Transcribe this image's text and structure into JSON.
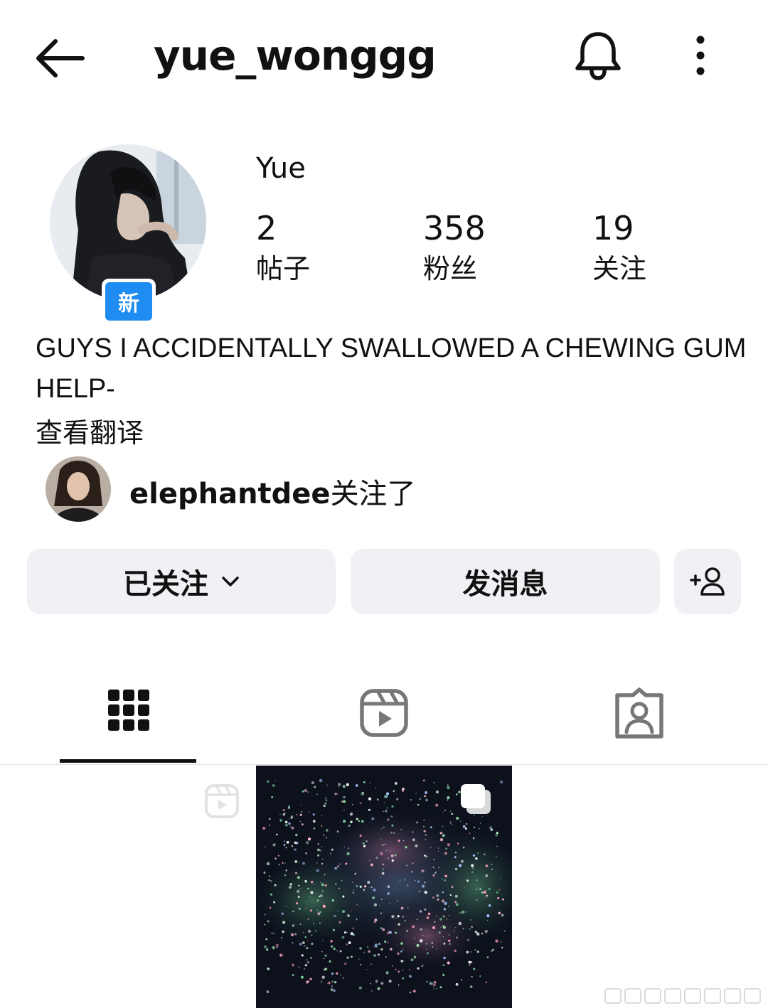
{
  "header": {
    "username": "yue_wonggg",
    "back_icon": "arrow-left-icon",
    "notification_icon": "bell-icon",
    "menu_icon": "more-vertical-icon"
  },
  "profile": {
    "display_name": "Yue",
    "new_badge": "新",
    "stats": [
      {
        "value": "2",
        "label": "帖子"
      },
      {
        "value": "358",
        "label": "粉丝"
      },
      {
        "value": "19",
        "label": "关注"
      }
    ],
    "bio": "GUYS I ACCIDENTALLY SWALLOWED A CHEWING GUM HELP-",
    "translate_link": "查看翻译",
    "followed_by": {
      "username": "elephantdee",
      "suffix": "关注了"
    }
  },
  "actions": {
    "following_label": "已关注",
    "message_label": "发消息",
    "add_user_icon": "add-user-icon"
  },
  "tabs": [
    {
      "name": "posts",
      "icon": "grid-icon",
      "active": true
    },
    {
      "name": "reels",
      "icon": "reels-icon",
      "active": false
    },
    {
      "name": "tagged",
      "icon": "tagged-person-icon",
      "active": false
    }
  ],
  "colors": {
    "badge_blue": "#1e8cf0",
    "button_bg": "#eff1f4",
    "text": "#111111"
  }
}
